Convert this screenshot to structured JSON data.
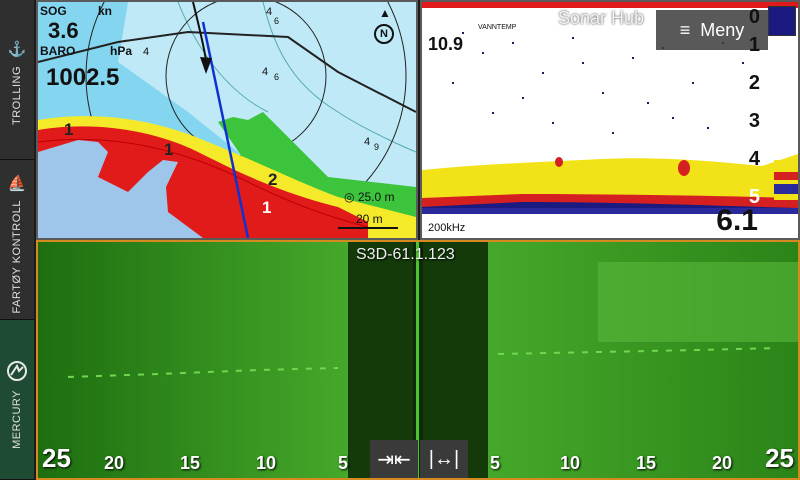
{
  "sidebar": {
    "tabs": [
      {
        "label": "TROLLING",
        "icon": "trolling-icon"
      },
      {
        "label": "FARTØY KONTROLL",
        "icon": "boat-icon"
      },
      {
        "label": "MERCURY",
        "icon": "mercury-logo-icon"
      }
    ]
  },
  "chart": {
    "sog_label": "SOG",
    "sog_unit": "kn",
    "sog_value": "3.6",
    "baro_label": "BARO",
    "baro_unit": "hPa",
    "baro_value": "1002.5",
    "north_label": "N",
    "range_ring": "25.0 m",
    "scale_bar": "20 m",
    "depth_numbers": [
      "1",
      "1",
      "2",
      "1",
      "4",
      "4",
      "6",
      "4",
      "6",
      "4",
      "9",
      "4"
    ]
  },
  "sonar": {
    "title": "Sonar Hub",
    "menu_label": "Meny",
    "watertemp_label": "VANNTEMP",
    "watertemp_value": "10.9",
    "frequency": "200kHz",
    "depth_readout": "6.1",
    "depth_scale": [
      "0",
      "1",
      "2",
      "3",
      "4",
      "5"
    ]
  },
  "s3d": {
    "source": "S3D-61.1.123",
    "range_left": [
      "25",
      "20",
      "15",
      "10",
      "5"
    ],
    "range_right": [
      "5",
      "10",
      "15",
      "20",
      "25"
    ]
  },
  "colors": {
    "chart_water": "#7fd3ee",
    "chart_land_red": "#e11a1a",
    "chart_shallow_yellow": "#f4ea2a",
    "chart_green": "#3cc43c",
    "s3d_active_border": "#d48a1f",
    "s3d_green": "#2e8a16"
  }
}
